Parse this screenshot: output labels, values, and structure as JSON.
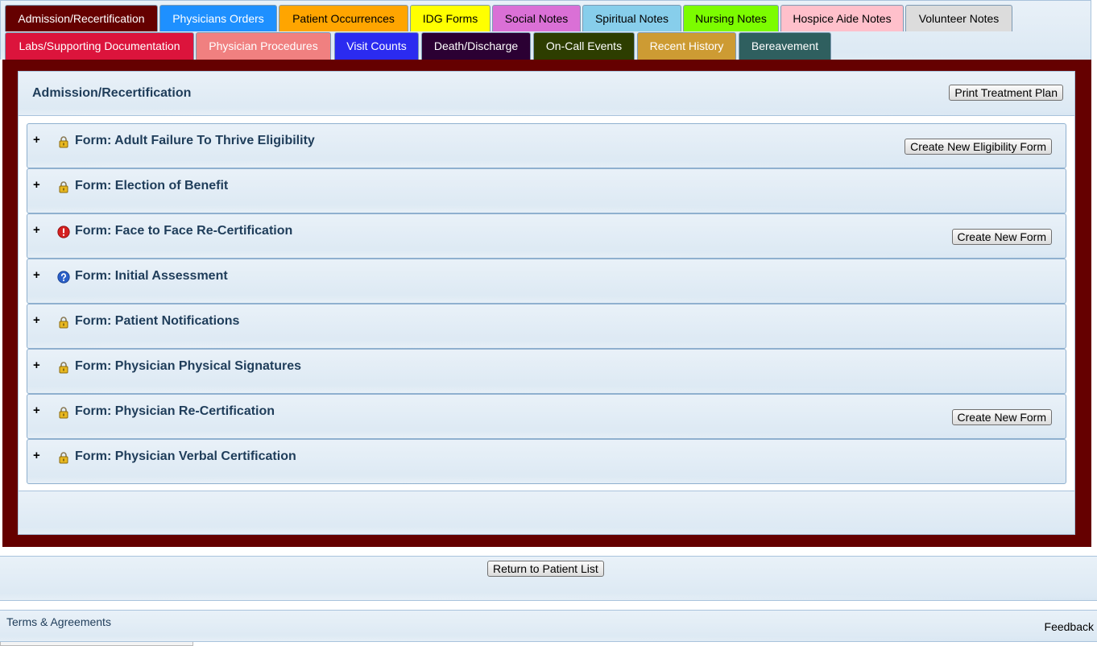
{
  "tabs_row1": [
    {
      "label": "Admission/Recertification",
      "bg": "#650000",
      "color": "#ffffff"
    },
    {
      "label": "Physicians Orders",
      "bg": "#1e90ff",
      "color": "#ffffff"
    },
    {
      "label": "Patient Occurrences",
      "bg": "#ffa500",
      "color": "#000000"
    },
    {
      "label": "IDG Forms",
      "bg": "#ffff00",
      "color": "#000000"
    },
    {
      "label": "Social Notes",
      "bg": "#da70d6",
      "color": "#000000"
    },
    {
      "label": "Spiritual Notes",
      "bg": "#87ceeb",
      "color": "#000000"
    },
    {
      "label": "Nursing Notes",
      "bg": "#7cfc00",
      "color": "#000000"
    },
    {
      "label": "Hospice Aide Notes",
      "bg": "#ffc0cb",
      "color": "#000000"
    },
    {
      "label": "Volunteer Notes",
      "bg": "#dcdcdc",
      "color": "#000000"
    }
  ],
  "tabs_row2": [
    {
      "label": "Labs/Supporting Documentation",
      "bg": "#dc143c",
      "color": "#ffffff"
    },
    {
      "label": "Physician Procedures",
      "bg": "#f08080",
      "color": "#ffffff"
    },
    {
      "label": "Visit Counts",
      "bg": "#2b2bf0",
      "color": "#ffffff"
    },
    {
      "label": "Death/Discharge",
      "bg": "#2b0033",
      "color": "#ffffff"
    },
    {
      "label": "On-Call Events",
      "bg": "#2d3d00",
      "color": "#ffffff"
    },
    {
      "label": "Recent History",
      "bg": "#cd9b33",
      "color": "#ffffff"
    },
    {
      "label": "Bereavement",
      "bg": "#2f5f5f",
      "color": "#ffffff"
    }
  ],
  "section": {
    "title": "Admission/Recertification",
    "print_button": "Print Treatment Plan"
  },
  "forms": [
    {
      "label": "Form: Adult Failure To Thrive Eligibility",
      "icon": "lock-icon",
      "button": "Create New Eligibility Form"
    },
    {
      "label": "Form: Election of Benefit",
      "icon": "lock-icon",
      "button": ""
    },
    {
      "label": "Form: Face to Face Re-Certification",
      "icon": "alert-icon",
      "button": "Create New Form"
    },
    {
      "label": "Form: Initial Assessment",
      "icon": "question-icon",
      "button": ""
    },
    {
      "label": "Form: Patient Notifications",
      "icon": "lock-icon",
      "button": ""
    },
    {
      "label": "Form: Physician Physical Signatures",
      "icon": "lock-icon",
      "button": ""
    },
    {
      "label": "Form: Physician Re-Certification",
      "icon": "lock-icon",
      "button": "Create New Form"
    },
    {
      "label": "Form: Physician Verbal Certification",
      "icon": "lock-icon",
      "button": ""
    }
  ],
  "expand_symbol": "+",
  "return_button": "Return to Patient List",
  "footer": {
    "terms": "Terms & Agreements",
    "feedback": "Feedback"
  },
  "colors": {
    "frame": "#650000",
    "panel_border": "#a9c3dc",
    "title_text": "#1f3d5a"
  }
}
